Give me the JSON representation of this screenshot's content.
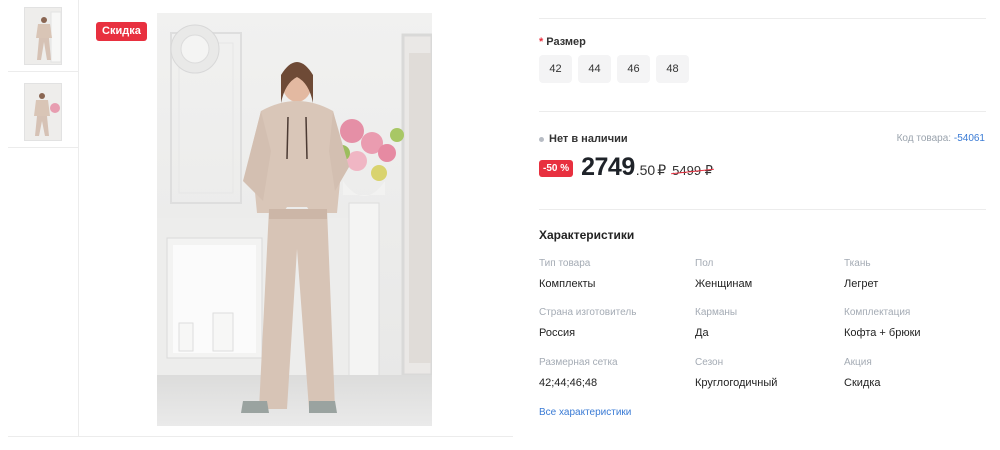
{
  "badges": {
    "sale": "Скидка",
    "discount": "-50 %"
  },
  "sizes": {
    "label": "Размер",
    "required_mark": "*",
    "options": [
      "42",
      "44",
      "46",
      "48"
    ]
  },
  "stock": {
    "status": "Нет в наличии"
  },
  "product_code": {
    "label": "Код товара:",
    "value": "-54061"
  },
  "price": {
    "current_main": "2749",
    "current_fraction": ".50",
    "currency": "₽",
    "old": "5499 ₽"
  },
  "characteristics": {
    "title": "Характеристики",
    "items": [
      {
        "key": "Тип товара",
        "value": "Комплекты"
      },
      {
        "key": "Пол",
        "value": "Женщинам"
      },
      {
        "key": "Ткань",
        "value": "Легрет"
      },
      {
        "key": "Страна изготовитель",
        "value": "Россия"
      },
      {
        "key": "Карманы",
        "value": "Да"
      },
      {
        "key": "Комплектация",
        "value": "Кофта + брюки"
      },
      {
        "key": "Размерная сетка",
        "value": "42;44;46;48"
      },
      {
        "key": "Сезон",
        "value": "Круглогодичный"
      },
      {
        "key": "Акция",
        "value": "Скидка"
      }
    ],
    "all_link": "Все характеристики"
  },
  "colors": {
    "accent_red": "#e8303f",
    "link_blue": "#3a7bd5",
    "muted": "#a4abb4"
  }
}
